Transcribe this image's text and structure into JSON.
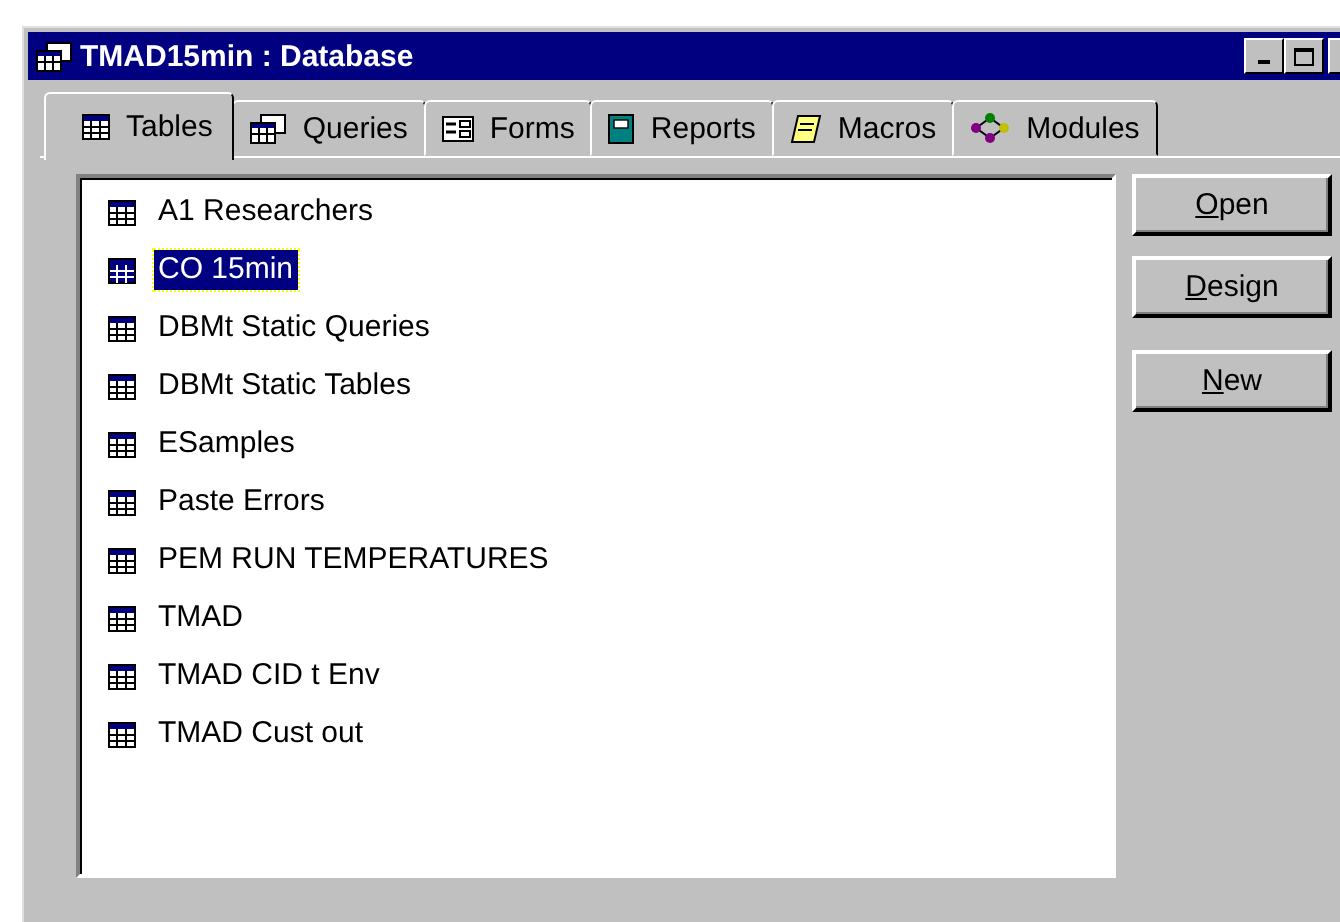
{
  "window": {
    "title": "TMAD15min : Database"
  },
  "tabs": [
    {
      "label": "Tables",
      "kind": "table",
      "selected": true
    },
    {
      "label": "Queries",
      "kind": "query",
      "selected": false
    },
    {
      "label": "Forms",
      "kind": "form",
      "selected": false
    },
    {
      "label": "Reports",
      "kind": "report",
      "selected": false
    },
    {
      "label": "Macros",
      "kind": "macro",
      "selected": false
    },
    {
      "label": "Modules",
      "kind": "module",
      "selected": false
    }
  ],
  "objects": [
    {
      "name": "A1 Researchers",
      "selected": false
    },
    {
      "name": "CO 15min",
      "selected": true
    },
    {
      "name": "DBMt Static Queries",
      "selected": false
    },
    {
      "name": "DBMt Static Tables",
      "selected": false
    },
    {
      "name": "ESamples",
      "selected": false
    },
    {
      "name": "Paste Errors",
      "selected": false
    },
    {
      "name": "PEM RUN TEMPERATURES",
      "selected": false
    },
    {
      "name": "TMAD",
      "selected": false
    },
    {
      "name": "TMAD CID t Env",
      "selected": false
    },
    {
      "name": "TMAD Cust out",
      "selected": false
    }
  ],
  "buttons": [
    {
      "label": "Open"
    },
    {
      "label": "Design"
    },
    {
      "label": "New"
    }
  ]
}
